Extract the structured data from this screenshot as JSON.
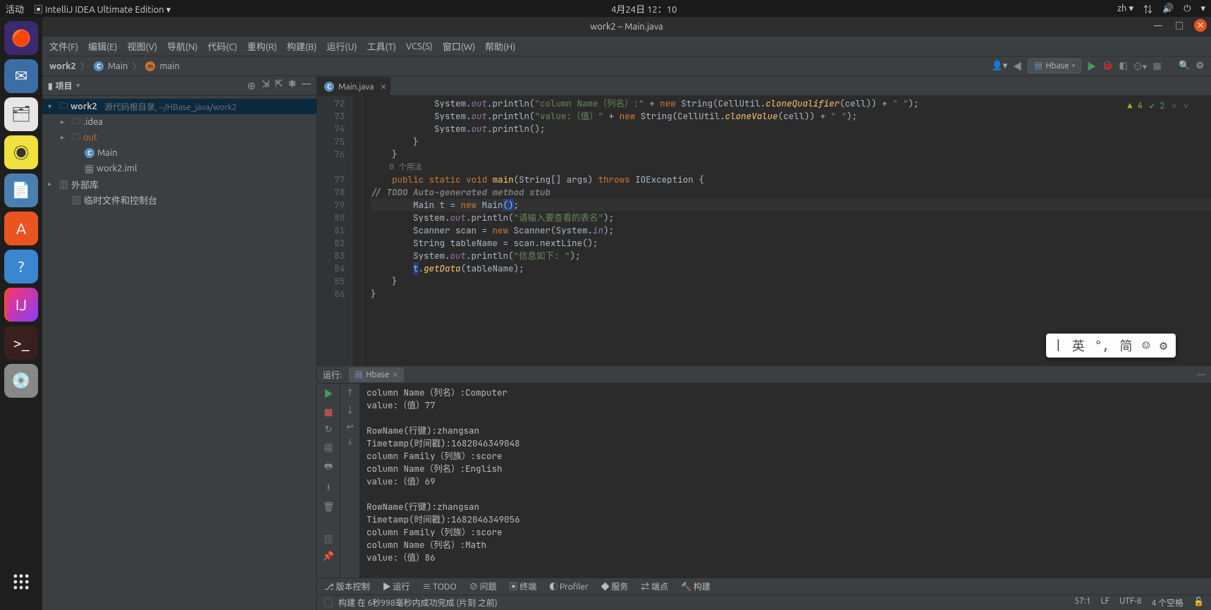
{
  "system_bar": {
    "activities": "活动",
    "app_menu": "IntelliJ IDEA Ultimate Edition ▾",
    "datetime": "4月24日  12：10",
    "input_method": "zh ▾"
  },
  "title_bar": {
    "title": "work2 – Main.java"
  },
  "menubar": {
    "file": "文件(F)",
    "edit": "编辑(E)",
    "view": "视图(V)",
    "navigate": "导航(N)",
    "code": "代码(C)",
    "refactor": "重构(R)",
    "build": "构建(B)",
    "run": "运行(U)",
    "tools": "工具(T)",
    "vcs": "VCS(S)",
    "window": "窗口(W)",
    "help": "帮助(H)"
  },
  "navbar": {
    "project": "work2",
    "file": "Main",
    "method": "main",
    "run_config": "Hbase"
  },
  "project_tw": {
    "title": "项目",
    "root": "work2",
    "root_hint": "源代码根目录, ~/HBase_java/work2",
    "idea": ".idea",
    "out": "out",
    "main_class": "Main",
    "iml": "work2.iml",
    "ext_libs": "外部库",
    "scratches": "临时文件和控制台"
  },
  "editor": {
    "tab_name": "Main.java",
    "inspections": {
      "warnings": "4",
      "ok": "2"
    },
    "line_numbers": [
      "72",
      "73",
      "74",
      "75",
      "76",
      "",
      "77",
      "78",
      "79",
      "80",
      "81",
      "82",
      "83",
      "84",
      "85",
      "86"
    ],
    "usages_label": "0 个用法",
    "lines_raw": [
      "            System.<fld>out</fld>.println(<str>\"column Name（列名）:\"</str> + <kw>new</kw> String(CellUtil.<mth>cloneQualifier</mth>(cell)) + <str>\" \"</str>);",
      "            System.<fld>out</fld>.println(<str>\"value:（值）\"</str> + <kw>new</kw> String(CellUtil.<mth>cloneValue</mth>(cell)) + <str>\" \"</str>);",
      "            System.<fld>out</fld>.println();",
      "        }",
      "    }",
      "    <usage>0 个用法</usage>",
      "    <kw>public</kw> <kw>static</kw> <kw>void</kw> <fn>main</fn>(String[] args) <kw>throws</kw> IOException {",
      "<cmt>// TODO Auto-generated method stub</cmt>",
      "        Main t = <kw>new</kw> Main<sel>()</sel>;",
      "        System.<fld>out</fld>.println(<str>\"请输入要查看的表名\"</str>);",
      "        Scanner scan = <kw>new</kw> Scanner(System.<fld>in</fld>);",
      "        String tableName = scan.nextLine();",
      "        System.<fld>out</fld>.println(<str>\"信息如下: \"</str>);",
      "        <sel>t</sel>.<mth>getData</mth>(tableName);",
      "    }",
      "}"
    ]
  },
  "run_tw": {
    "title_label": "运行:",
    "tab": "Hbase",
    "console_lines": [
      "column Name（列名）:Computer",
      "value:（值）77",
      "",
      "RowName(行键):zhangsan",
      "Timetamp(时间戳):1682046349048",
      "column Family（列族）:score",
      "column Name（列名）:English",
      "value:（值）69",
      "",
      "RowName(行键):zhangsan",
      "Timetamp(时间戳):1682046349056",
      "column Family（列族）:score",
      "column Name（列名）:Math",
      "value:（值）86"
    ]
  },
  "ime": {
    "lang1": "英",
    "lang2": "简"
  },
  "bottombar": {
    "vcs": "版本控制",
    "run": "运行",
    "todo": "TODO",
    "problems": "问题",
    "terminal": "终端",
    "profiler": "Profiler",
    "services": "服务",
    "endpoints": "端点",
    "build": "构建"
  },
  "statusbar": {
    "message": "构建 在 6秒998毫秒内成功完成 (片刻 之前)",
    "caret": "57:1",
    "lf": "LF",
    "enc": "UTF-8",
    "indent": "4 个空格"
  }
}
